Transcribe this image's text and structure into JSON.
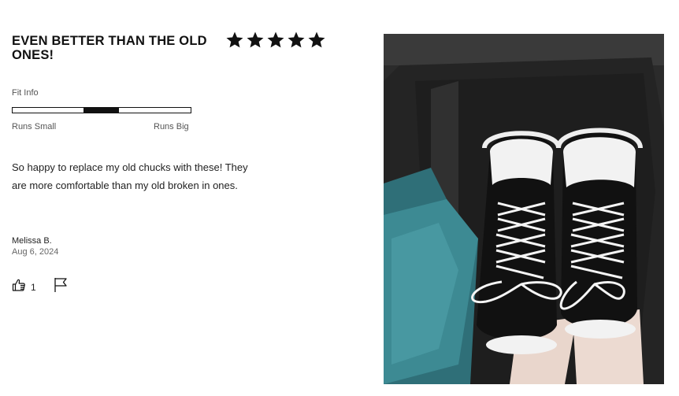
{
  "review": {
    "title": "EVEN BETTER THAN THE OLD ONES!",
    "rating": 5,
    "rating_max": 5,
    "fit": {
      "label": "Fit Info",
      "min_label": "Runs Small",
      "max_label": "Runs Big",
      "value": 0.4
    },
    "body": "So happy to replace my old chucks with these! They are more comfortable than my old broken in ones.",
    "author": "Melissa B.",
    "date": "Aug 6, 2024",
    "helpful_count": "1"
  },
  "icons": {
    "star": "star-icon",
    "helpful": "thumbs-up-icon",
    "report": "flag-icon"
  },
  "colors": {
    "text": "#111111",
    "star": "#111111"
  }
}
